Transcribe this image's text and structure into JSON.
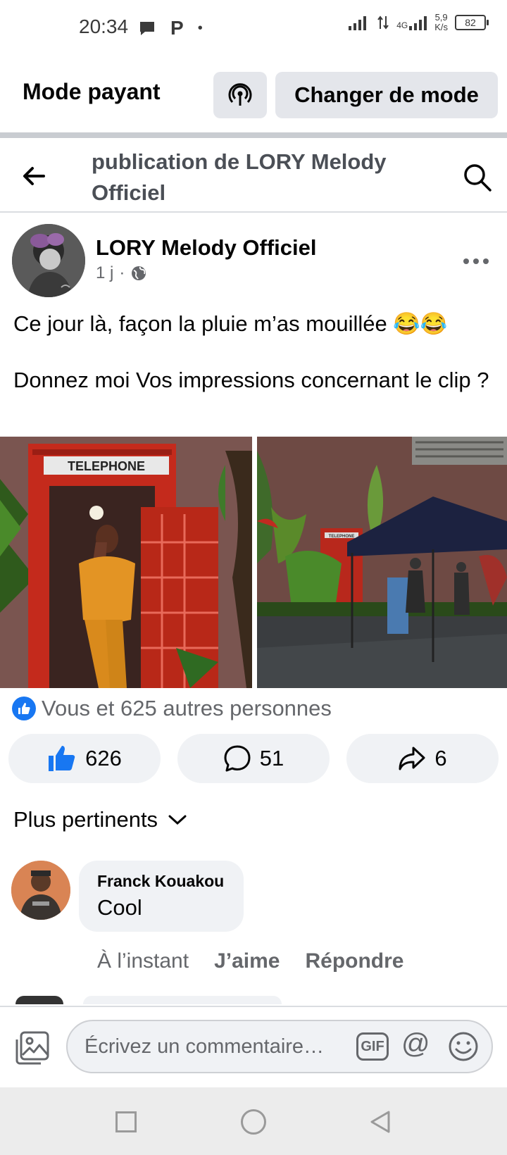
{
  "status_bar": {
    "time": "20:34",
    "left_icons": [
      "chat-bubble-icon",
      "p-icon",
      "dot-icon"
    ],
    "network": "4G",
    "speed": "5,9",
    "speed_unit": "K/s",
    "battery": "82"
  },
  "mode_bar": {
    "label": "Mode payant",
    "switch_label": "Changer de mode"
  },
  "header": {
    "title": "publication de LORY Melody Officiel"
  },
  "post": {
    "author": "LORY Melody Officiel",
    "time": "1 j",
    "separator": "·",
    "text_line1": "Ce jour là, façon la pluie m’as mouillée 😂😂",
    "text_line2": "Donnez moi Vos impressions concernant le clip ?",
    "photo1_sign": "TELEPHONE",
    "photo2_sign": "TELEPHONE"
  },
  "reactions": {
    "summary": "Vous et 625 autres personnes",
    "likes": "626",
    "comments": "51",
    "shares": "6"
  },
  "comments_section": {
    "sort_label": "Plus pertinents",
    "items": [
      {
        "author": "Franck Kouakou",
        "text": "Cool",
        "time": "À l’instant",
        "like_label": "J’aime",
        "reply_label": "Répondre"
      }
    ]
  },
  "composer": {
    "placeholder": "Écrivez un commentaire…",
    "gif_label": "GIF",
    "at_label": "@"
  }
}
